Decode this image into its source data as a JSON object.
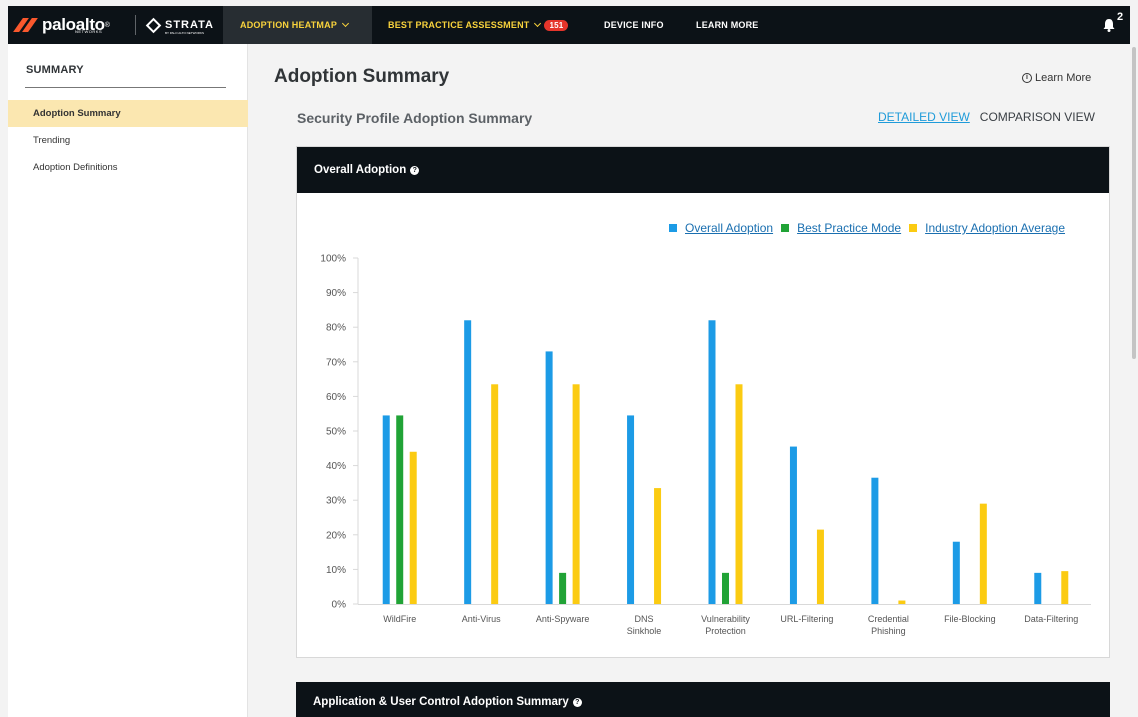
{
  "brand": {
    "name": "paloalto",
    "registered": "®",
    "sub": "NETWORKS",
    "product": "STRATA",
    "product_sub": "BY PALO ALTO NETWORKS"
  },
  "nav": {
    "adoption_heatmap": "ADOPTION HEATMAP",
    "best_practice": "BEST PRACTICE ASSESSMENT",
    "best_practice_count": "151",
    "device_info": "DEVICE INFO",
    "learn_more": "LEARN MORE",
    "notifications": "2"
  },
  "sidebar": {
    "title": "SUMMARY",
    "items": [
      {
        "label": "Adoption Summary",
        "active": true
      },
      {
        "label": "Trending",
        "active": false
      },
      {
        "label": "Adoption Definitions",
        "active": false
      }
    ]
  },
  "main": {
    "title": "Adoption Summary",
    "learn_more": "Learn More",
    "subtitle": "Security Profile Adoption Summary",
    "detailed_view": "DETAILED VIEW",
    "comparison_view": "COMPARISON VIEW",
    "panel_title": "Overall Adoption",
    "next_panel_title": "Application & User Control Adoption Summary"
  },
  "colors": {
    "overall": "#1c9be6",
    "best_practice": "#21a336",
    "industry": "#fbcb12",
    "accent": "#f9d33c"
  },
  "chart_data": {
    "type": "bar",
    "categories": [
      "WildFire",
      "Anti-Virus",
      "Anti-Spyware",
      "DNS Sinkhole",
      "Vulnerability Protection",
      "URL-Filtering",
      "Credential Phishing",
      "File-Blocking",
      "Data-Filtering"
    ],
    "category_lines": [
      [
        "WildFire"
      ],
      [
        "Anti-Virus"
      ],
      [
        "Anti-Spyware"
      ],
      [
        "DNS",
        "Sinkhole"
      ],
      [
        "Vulnerability",
        "Protection"
      ],
      [
        "URL-Filtering"
      ],
      [
        "Credential",
        "Phishing"
      ],
      [
        "File-Blocking"
      ],
      [
        "Data-Filtering"
      ]
    ],
    "series": [
      {
        "name": "Overall Adoption",
        "values": [
          54.5,
          82,
          73,
          54.5,
          82,
          45.5,
          36.5,
          18,
          9
        ]
      },
      {
        "name": "Best Practice Mode",
        "values": [
          54.5,
          0,
          9,
          0,
          9,
          0,
          0,
          0,
          0
        ]
      },
      {
        "name": "Industry Adoption Average",
        "values": [
          44,
          63.5,
          63.5,
          33.5,
          63.5,
          21.5,
          1,
          29,
          9.5
        ]
      }
    ],
    "yticks": [
      "0%",
      "10%",
      "20%",
      "30%",
      "40%",
      "50%",
      "60%",
      "70%",
      "80%",
      "90%",
      "100%"
    ],
    "ylim": [
      0,
      100
    ],
    "legend_position": "top-right",
    "grid": false
  }
}
